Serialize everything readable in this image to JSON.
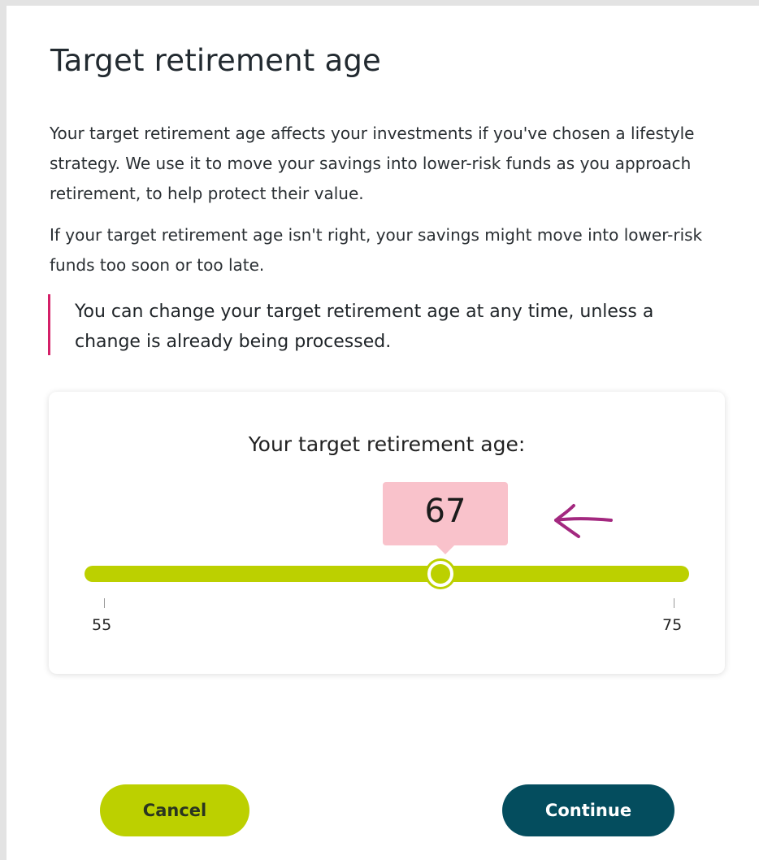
{
  "modal": {
    "title": "Target retirement age",
    "paragraphs": [
      "Your target retirement age affects your investments if you've chosen a lifestyle strategy. We use it to move your savings into lower-risk funds as you approach retirement, to help protect their value.",
      "If your target retirement age isn't right, your savings might move into lower-risk funds too soon or too late."
    ],
    "callout": "You can change your target retirement age at any time, unless a change is already being processed.",
    "callout_border_color": "#d42068"
  },
  "slider": {
    "label": "Your target retirement age:",
    "value": "67",
    "min": "55",
    "max": "75",
    "track_color": "#bcd000",
    "bubble_color": "#f9c2cb"
  },
  "annotation": {
    "icon": "arrow-left-icon",
    "color": "#a3287f"
  },
  "buttons": {
    "cancel_label": "Cancel",
    "cancel_color": "#bcd000",
    "continue_label": "Continue",
    "continue_color": "#044d5e"
  }
}
